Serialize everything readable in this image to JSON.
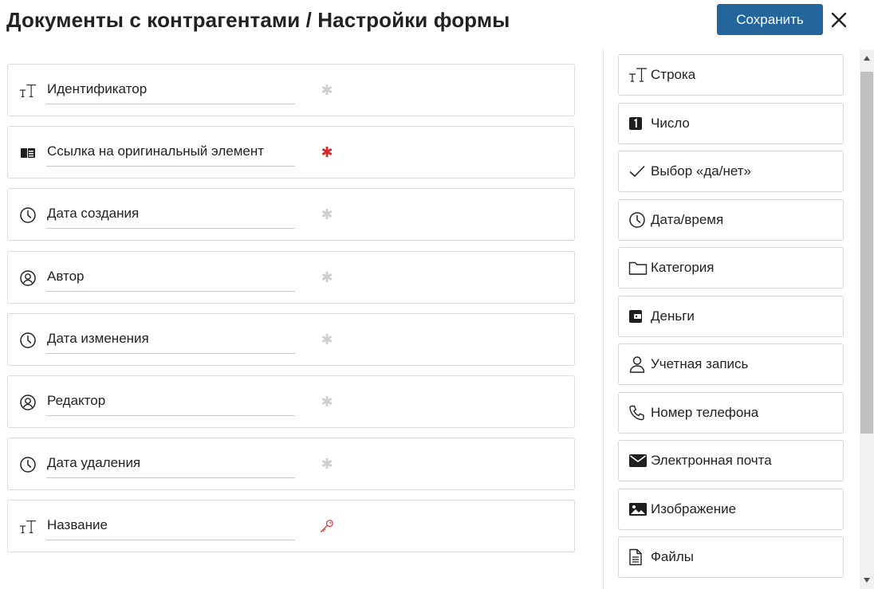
{
  "header": {
    "title": "Документы с контрагентами / Настройки формы",
    "save_label": "Сохранить",
    "close_icon": "close-icon",
    "accent_color": "#24669c"
  },
  "fields": [
    {
      "label": "Идентификатор",
      "icon": "text-type-icon",
      "required": false
    },
    {
      "label": "Ссылка на оригинальный элемент",
      "icon": "link-element-icon",
      "required": true
    },
    {
      "label": "Дата создания",
      "icon": "clock-icon",
      "required": false
    },
    {
      "label": "Автор",
      "icon": "user-circle-icon",
      "required": false
    },
    {
      "label": "Дата изменения",
      "icon": "clock-icon",
      "required": false
    },
    {
      "label": "Редактор",
      "icon": "user-circle-icon",
      "required": false
    },
    {
      "label": "Дата удаления",
      "icon": "clock-icon",
      "required": false
    },
    {
      "label": "Название",
      "icon": "text-type-icon",
      "key": true
    }
  ],
  "field_types": [
    {
      "label": "Строка",
      "icon": "text-type-icon"
    },
    {
      "label": "Число",
      "icon": "number-one-icon"
    },
    {
      "label": "Выбор «да/нет»",
      "icon": "checkmark-icon"
    },
    {
      "label": "Дата/время",
      "icon": "clock-icon"
    },
    {
      "label": "Категория",
      "icon": "folder-icon"
    },
    {
      "label": "Деньги",
      "icon": "wallet-icon"
    },
    {
      "label": "Учетная запись",
      "icon": "user-icon"
    },
    {
      "label": "Номер телефона",
      "icon": "phone-icon"
    },
    {
      "label": "Электронная почта",
      "icon": "envelope-icon"
    },
    {
      "label": "Изображение",
      "icon": "image-icon"
    },
    {
      "label": "Файлы",
      "icon": "file-icon"
    }
  ],
  "colors": {
    "required_active": "#d62a2a",
    "required_inactive": "#cfcfcf",
    "key_icon": "#d62a2a"
  }
}
